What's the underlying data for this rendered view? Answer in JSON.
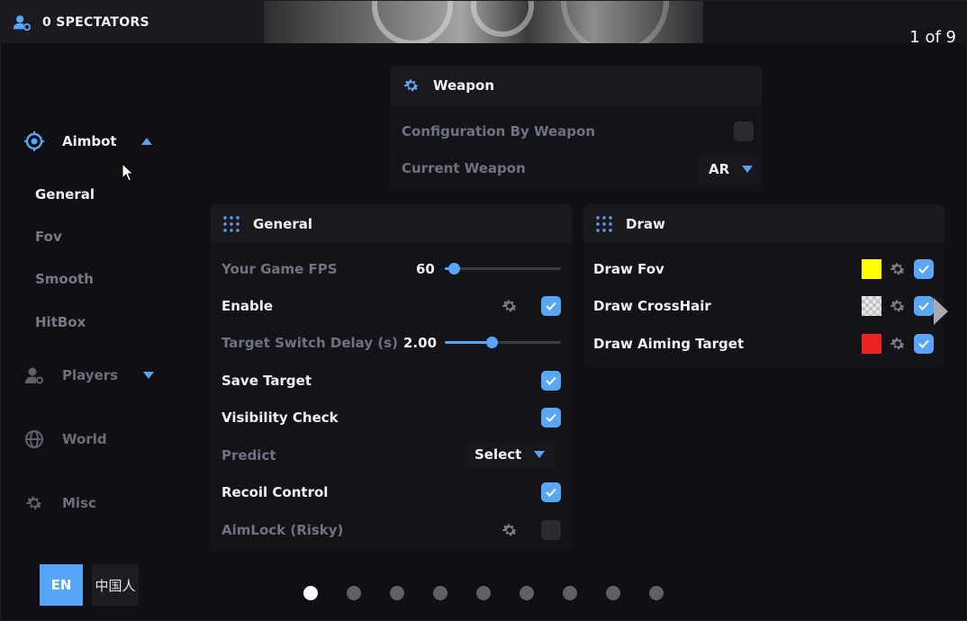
{
  "top": {
    "spectators_label": "0 SPECTATORS",
    "page_counter": "1 of 9"
  },
  "sidebar": {
    "aimbot": {
      "label": "Aimbot",
      "expanded": true,
      "subitems": [
        "General",
        "Fov",
        "Smooth",
        "HitBox"
      ],
      "active_subitem": "General"
    },
    "players": {
      "label": "Players",
      "expanded": false
    },
    "world": {
      "label": "World"
    },
    "misc": {
      "label": "Misc"
    }
  },
  "language": {
    "en": "EN",
    "cn": "中国人",
    "selected": "EN"
  },
  "weapon_panel": {
    "title": "Weapon",
    "config_by_weapon_label": "Configuration By Weapon",
    "config_by_weapon_checked": false,
    "current_weapon_label": "Current Weapon",
    "current_weapon_value": "AR"
  },
  "general_panel": {
    "title": "General",
    "fps": {
      "label": "Your Game FPS",
      "value": "60",
      "fraction": 0.08
    },
    "enable": {
      "label": "Enable",
      "checked": true
    },
    "switch_delay": {
      "label": "Target Switch Delay (s)",
      "value": "2.00",
      "fraction": 0.41
    },
    "save_target": {
      "label": "Save Target",
      "checked": true
    },
    "visibility_check": {
      "label": "Visibility Check",
      "checked": true
    },
    "predict": {
      "label": "Predict",
      "value": "Select"
    },
    "recoil_control": {
      "label": "Recoil Control",
      "checked": true
    },
    "aimlock": {
      "label": "AimLock (Risky)",
      "checked": false
    }
  },
  "draw_panel": {
    "title": "Draw",
    "items": [
      {
        "label": "Draw Fov",
        "color": "#ffff00",
        "checked": true
      },
      {
        "label": "Draw CrossHair",
        "color": "checker",
        "checked": true
      },
      {
        "label": "Draw Aiming Target",
        "color": "#ee2222",
        "checked": true
      }
    ]
  },
  "pagination": {
    "total": 9,
    "current": 1
  },
  "colors": {
    "accent": "#5aa6f6",
    "panel": "#141418",
    "background": "#101014"
  }
}
